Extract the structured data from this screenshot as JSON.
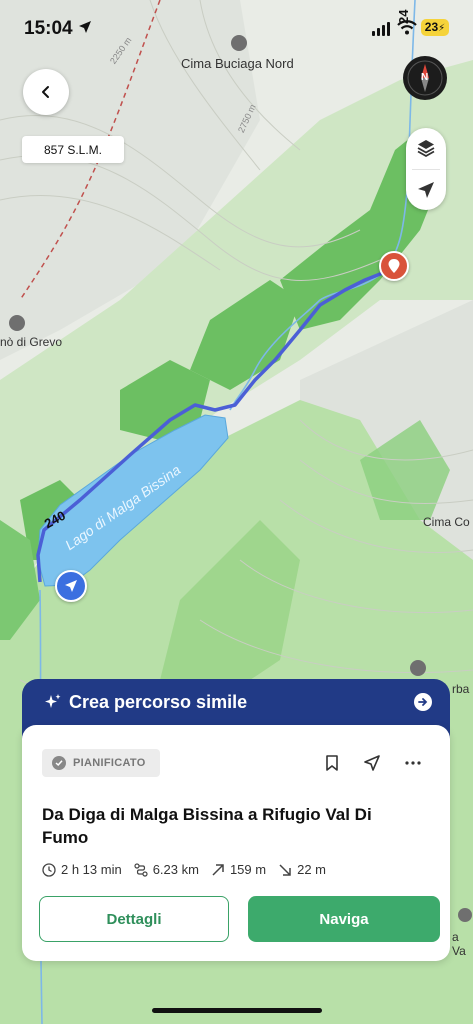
{
  "status_bar": {
    "time": "15:04",
    "battery": "23"
  },
  "map": {
    "peak_labels": [
      "Cima Buciaga Nord",
      "Cima Co",
      "rba",
      "a Va"
    ],
    "place_label": "nò di Grevo",
    "contour_labels": [
      "2250 m",
      "2750 m"
    ],
    "trail_number_labels": [
      "240",
      "24"
    ],
    "lake_label": "Lago di Malga Bissina",
    "colors": {
      "route": "#4b5fd6",
      "lake": "#7dc3ee",
      "forest": "#6cbf62",
      "destination_pin": "#d9533b",
      "start_marker": "#3b6fe0"
    }
  },
  "controls": {
    "back_icon": "chevron-left-icon",
    "altitude": "857 S.L.M.",
    "compass_letter": "N",
    "layers_icon": "layers-icon",
    "locate_icon": "location-arrow-icon"
  },
  "banner": {
    "label": "Crea percorso simile",
    "icon": "sparkle-icon",
    "arrow_icon": "arrow-right-icon"
  },
  "card": {
    "status_badge": "PIANIFICATO",
    "actions": [
      "bookmark-icon",
      "share-icon",
      "more-icon"
    ],
    "title": "Da Diga di Malga Bissina a Rifugio Val Di Fumo",
    "stats": {
      "duration": "2 h 13 min",
      "distance": "6.23 km",
      "ascent": "159 m",
      "descent": "22 m"
    },
    "details_button": "Dettagli",
    "navigate_button": "Naviga"
  }
}
